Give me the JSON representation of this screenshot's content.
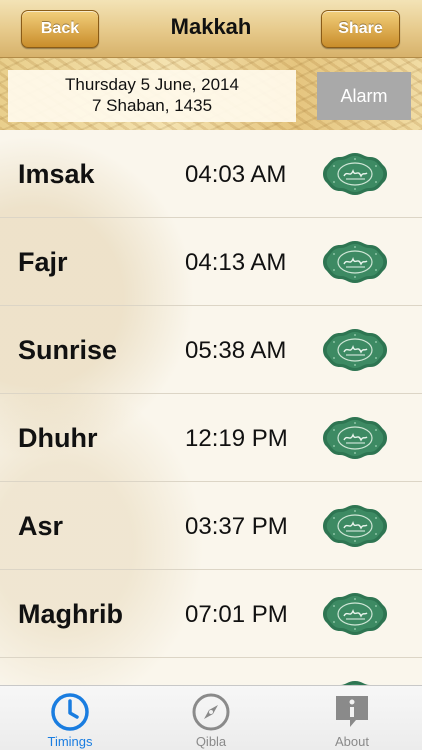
{
  "nav": {
    "title": "Makkah",
    "back_label": "Back",
    "share_label": "Share"
  },
  "header": {
    "gregorian_date": "Thursday 5 June, 2014",
    "hijri_date": "7 Shaban, 1435",
    "alarm_label": "Alarm"
  },
  "prayers": [
    {
      "name": "Imsak",
      "time": "04:03 AM"
    },
    {
      "name": "Fajr",
      "time": "04:13 AM"
    },
    {
      "name": "Sunrise",
      "time": "05:38 AM"
    },
    {
      "name": "Dhuhr",
      "time": "12:19 PM"
    },
    {
      "name": "Asr",
      "time": "03:37 PM"
    },
    {
      "name": "Maghrib",
      "time": "07:01 PM"
    },
    {
      "name": "",
      "time": ""
    }
  ],
  "icons": {
    "prayer_badge": "allah-calligraphy-badge-icon",
    "timings": "clock-icon",
    "qibla": "compass-icon",
    "about": "info-icon"
  },
  "tabs": [
    {
      "label": "Timings",
      "active": true
    },
    {
      "label": "Qibla",
      "active": false
    },
    {
      "label": "About",
      "active": false
    }
  ],
  "colors": {
    "accent": "#1a7de0",
    "badge_green": "#2f7a55",
    "nav_button": "#c98d2b",
    "alarm_button": "#a9a9a9"
  }
}
